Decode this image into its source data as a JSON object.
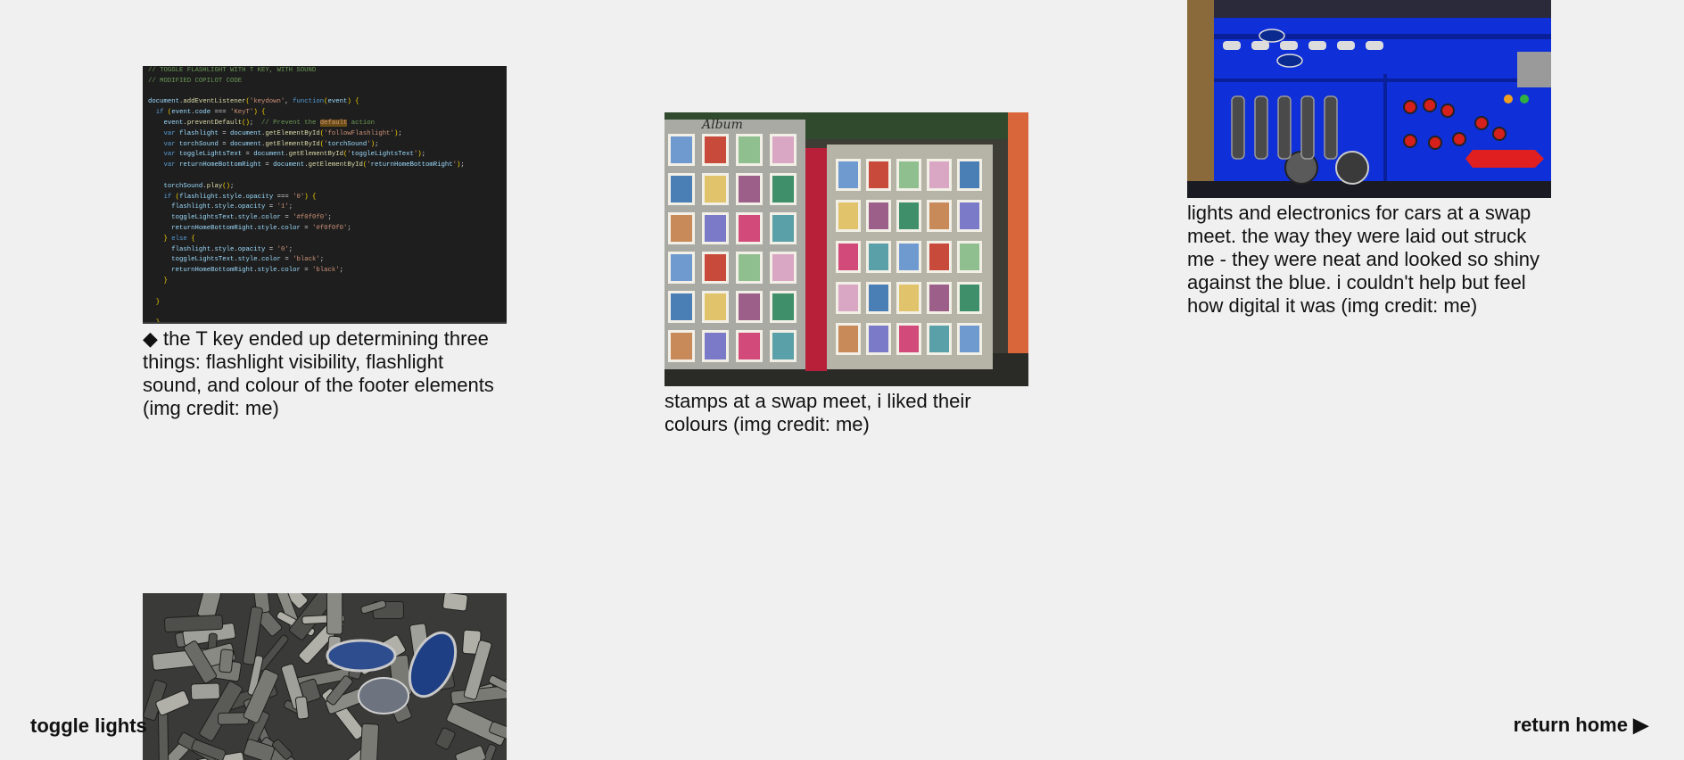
{
  "gallery": {
    "items": [
      {
        "caption": "◆ the T key ended up determining three things: flashlight visibility, flashlight sound, and colour of the footer elements (img credit: me)",
        "image": "code-editor-screenshot",
        "code_lines": [
          "// TOGGLE FLASHLIGHT WITH T KEY, WITH SOUND",
          "// MODIFIED COPILOT CODE",
          "",
          "document.addEventListener('keydown', function(event) {",
          "  if (event.code === 'KeyT') {",
          "    event.preventDefault();  // Prevent the default action",
          "    var flashlight = document.getElementById('followFlashlight');",
          "    var torchSound = document.getElementById('torchSound');",
          "    var toggleLightsText = document.getElementById('toggleLightsText');",
          "    var returnHomeBottomRight = document.getElementById('returnHomeBottomRight');",
          "",
          "    torchSound.play();",
          "    if (flashlight.style.opacity === '0') {",
          "      flashlight.style.opacity = '1';",
          "      toggleLightsText.style.color = '#f0f0f0';",
          "      returnHomeBottomRight.style.color = '#f0f0f0';",
          "    } else {",
          "      flashlight.style.opacity = '0';",
          "      toggleLightsText.style.color = 'black';",
          "      returnHomeBottomRight.style.color = 'black';",
          "    }",
          "",
          "  }",
          "",
          "  }",
          "});"
        ]
      },
      {
        "caption": "stamps at a swap meet, i liked their colours (img credit: me)",
        "image": "stamp-album-photo",
        "album_label": "Album"
      },
      {
        "caption": "lights and electronics for cars at a swap meet. the way they were laid out struck me - they were neat and looked so shiny against the blue. i couldn't help but feel how digital it was (img credit: me)",
        "image": "car-lights-photo"
      },
      {
        "caption": "",
        "image": "car-badges-photo"
      }
    ]
  },
  "footer": {
    "toggle_lights": "toggle lights",
    "return_home": "return home ▶"
  },
  "colors": {
    "background": "#f0f0f0",
    "text": "#111111",
    "code_bg": "#1e1e1e",
    "lights_blue": "#0d2bd6"
  }
}
